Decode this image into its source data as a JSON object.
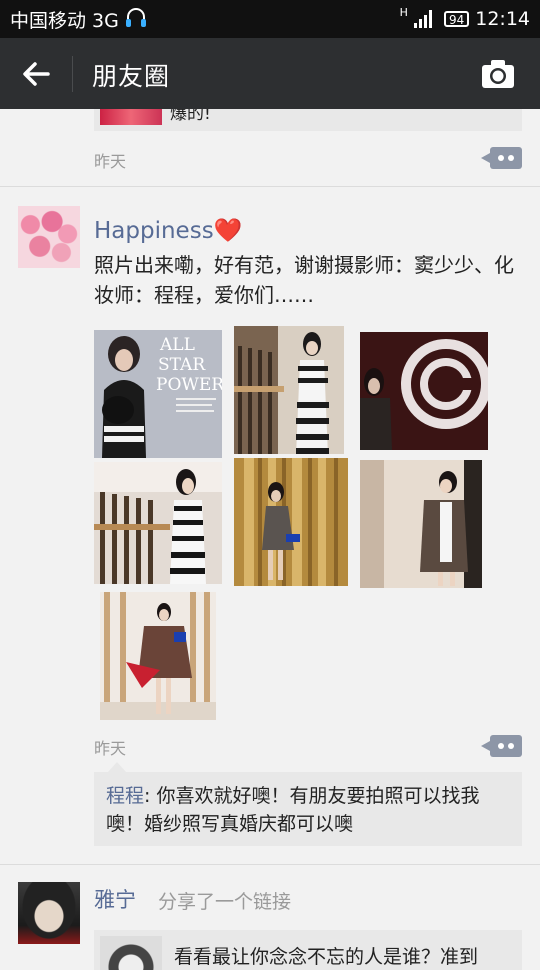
{
  "status_bar": {
    "carrier": "中国移动 3G",
    "battery": "94",
    "time": "12:14",
    "network_letter": "H"
  },
  "navbar": {
    "title": "朋友圈",
    "back_icon": "arrow-left-icon",
    "camera_icon": "camera-icon"
  },
  "prev_post": {
    "link_text": "爆的!",
    "time": "昨天"
  },
  "post": {
    "username": "Happiness",
    "heart": "❤️",
    "text": "照片出来嘞，好有范，谢谢摄影师：窦少少、化妆师：程程，爱你们……",
    "photo_count": 7,
    "photo_texts": {
      "magazine_line1": "ALL",
      "magazine_line2": "STAR",
      "magazine_line3": "POWER"
    },
    "time": "昨天",
    "comments": [
      {
        "author": "程程",
        "text": "你喜欢就好噢！有朋友要拍照可以找我噢！婚纱照写真婚庆都可以噢"
      }
    ]
  },
  "next_post": {
    "username": "雅宁",
    "action": "分享了一个链接",
    "link_title": "看看最让你念念不忘的人是谁？准到"
  },
  "colors": {
    "name_blue": "#576b95",
    "navbar_bg": "#2d2f31",
    "page_bg": "#f2f2f2"
  }
}
